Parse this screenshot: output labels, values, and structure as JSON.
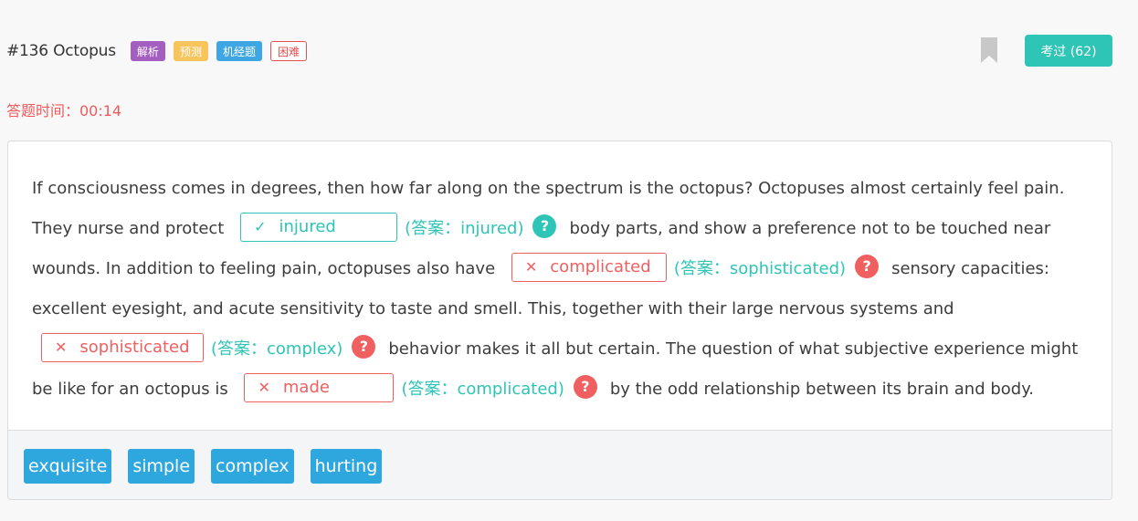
{
  "header": {
    "title": "#136 Octopus",
    "tags": [
      "解析",
      "预测",
      "机经题",
      "困难"
    ],
    "exam_button": "考过 (62)"
  },
  "timer": "答题时间：00:14",
  "passage": {
    "s1": "If consciousness comes in degrees, then how far along on the spectrum is the octopus? Octopuses almost certainly feel pain. They nurse and protect",
    "b1": {
      "mark": "✓",
      "value": "injured",
      "answer": "(答案：injured)",
      "status": "correct"
    },
    "s2": "body parts, and show a preference not to be touched near wounds. In addition to feeling pain, octopuses also have",
    "b2": {
      "mark": "✕",
      "value": "complicated",
      "answer": "(答案：sophisticated)",
      "status": "wrong"
    },
    "s3": "sensory capacities: excellent eyesight, and acute sensitivity to taste and smell. This, together with their large nervous systems and",
    "b3": {
      "mark": "✕",
      "value": "sophisticated",
      "answer": "(答案：complex)",
      "status": "wrong"
    },
    "s4": "behavior makes it all but certain. The question of what subjective experience might be like for an octopus is",
    "b4": {
      "mark": "✕",
      "value": "made",
      "answer": "(答案：complicated)",
      "status": "wrong"
    },
    "s5": "by the odd relationship between its brain and body."
  },
  "options": [
    "exquisite",
    "simple",
    "complex",
    "hurting"
  ],
  "colors": {
    "accent": "#2ec4b6",
    "error": "#f06060",
    "option": "#2ea7df"
  },
  "icons": {
    "help": "question-circle-icon",
    "bookmark": "bookmark-icon"
  }
}
